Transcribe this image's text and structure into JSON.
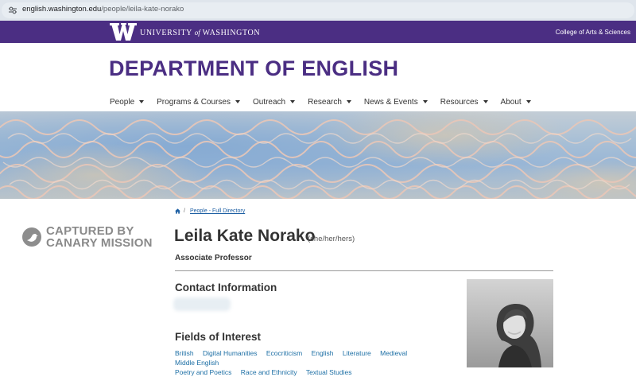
{
  "browser": {
    "url_domain": "english.washington.edu",
    "url_path": "/people/leila-kate-norako",
    "site_info_icon": "tune-icon"
  },
  "uw_bar": {
    "logo_icon": "uw-w-logo-icon",
    "name_before": "UNIVERSITY",
    "name_of": "of",
    "name_after": "WASHINGTON",
    "college_link": "College of Arts & Sciences",
    "color": "#4b2e83"
  },
  "department": {
    "title": "DEPARTMENT OF ENGLISH"
  },
  "nav": {
    "items": [
      {
        "label": "People"
      },
      {
        "label": "Programs & Courses"
      },
      {
        "label": "Outreach"
      },
      {
        "label": "Research"
      },
      {
        "label": "News & Events"
      },
      {
        "label": "Resources"
      },
      {
        "label": "About"
      }
    ]
  },
  "overlay": {
    "line1": "CAPTURED BY",
    "line2": "CANARY MISSION",
    "logo_icon": "canary-bird-icon"
  },
  "breadcrumb": {
    "home_icon": "home-icon",
    "separator": "/",
    "link": "People - Full Directory"
  },
  "profile": {
    "name": "Leila Kate Norako",
    "pronouns": "(she/her/hers)",
    "title": "Associate Professor",
    "contact_heading": "Contact Information",
    "fields_heading": "Fields of Interest",
    "fields": [
      "British",
      "Digital Humanities",
      "Ecocriticism",
      "English",
      "Literature",
      "Medieval",
      "Middle English",
      "Poetry and Poetics",
      "Race and Ethnicity",
      "Textual Studies"
    ]
  },
  "colors": {
    "accent_purple": "#4b2e83",
    "link_blue": "#1d6fa5"
  }
}
